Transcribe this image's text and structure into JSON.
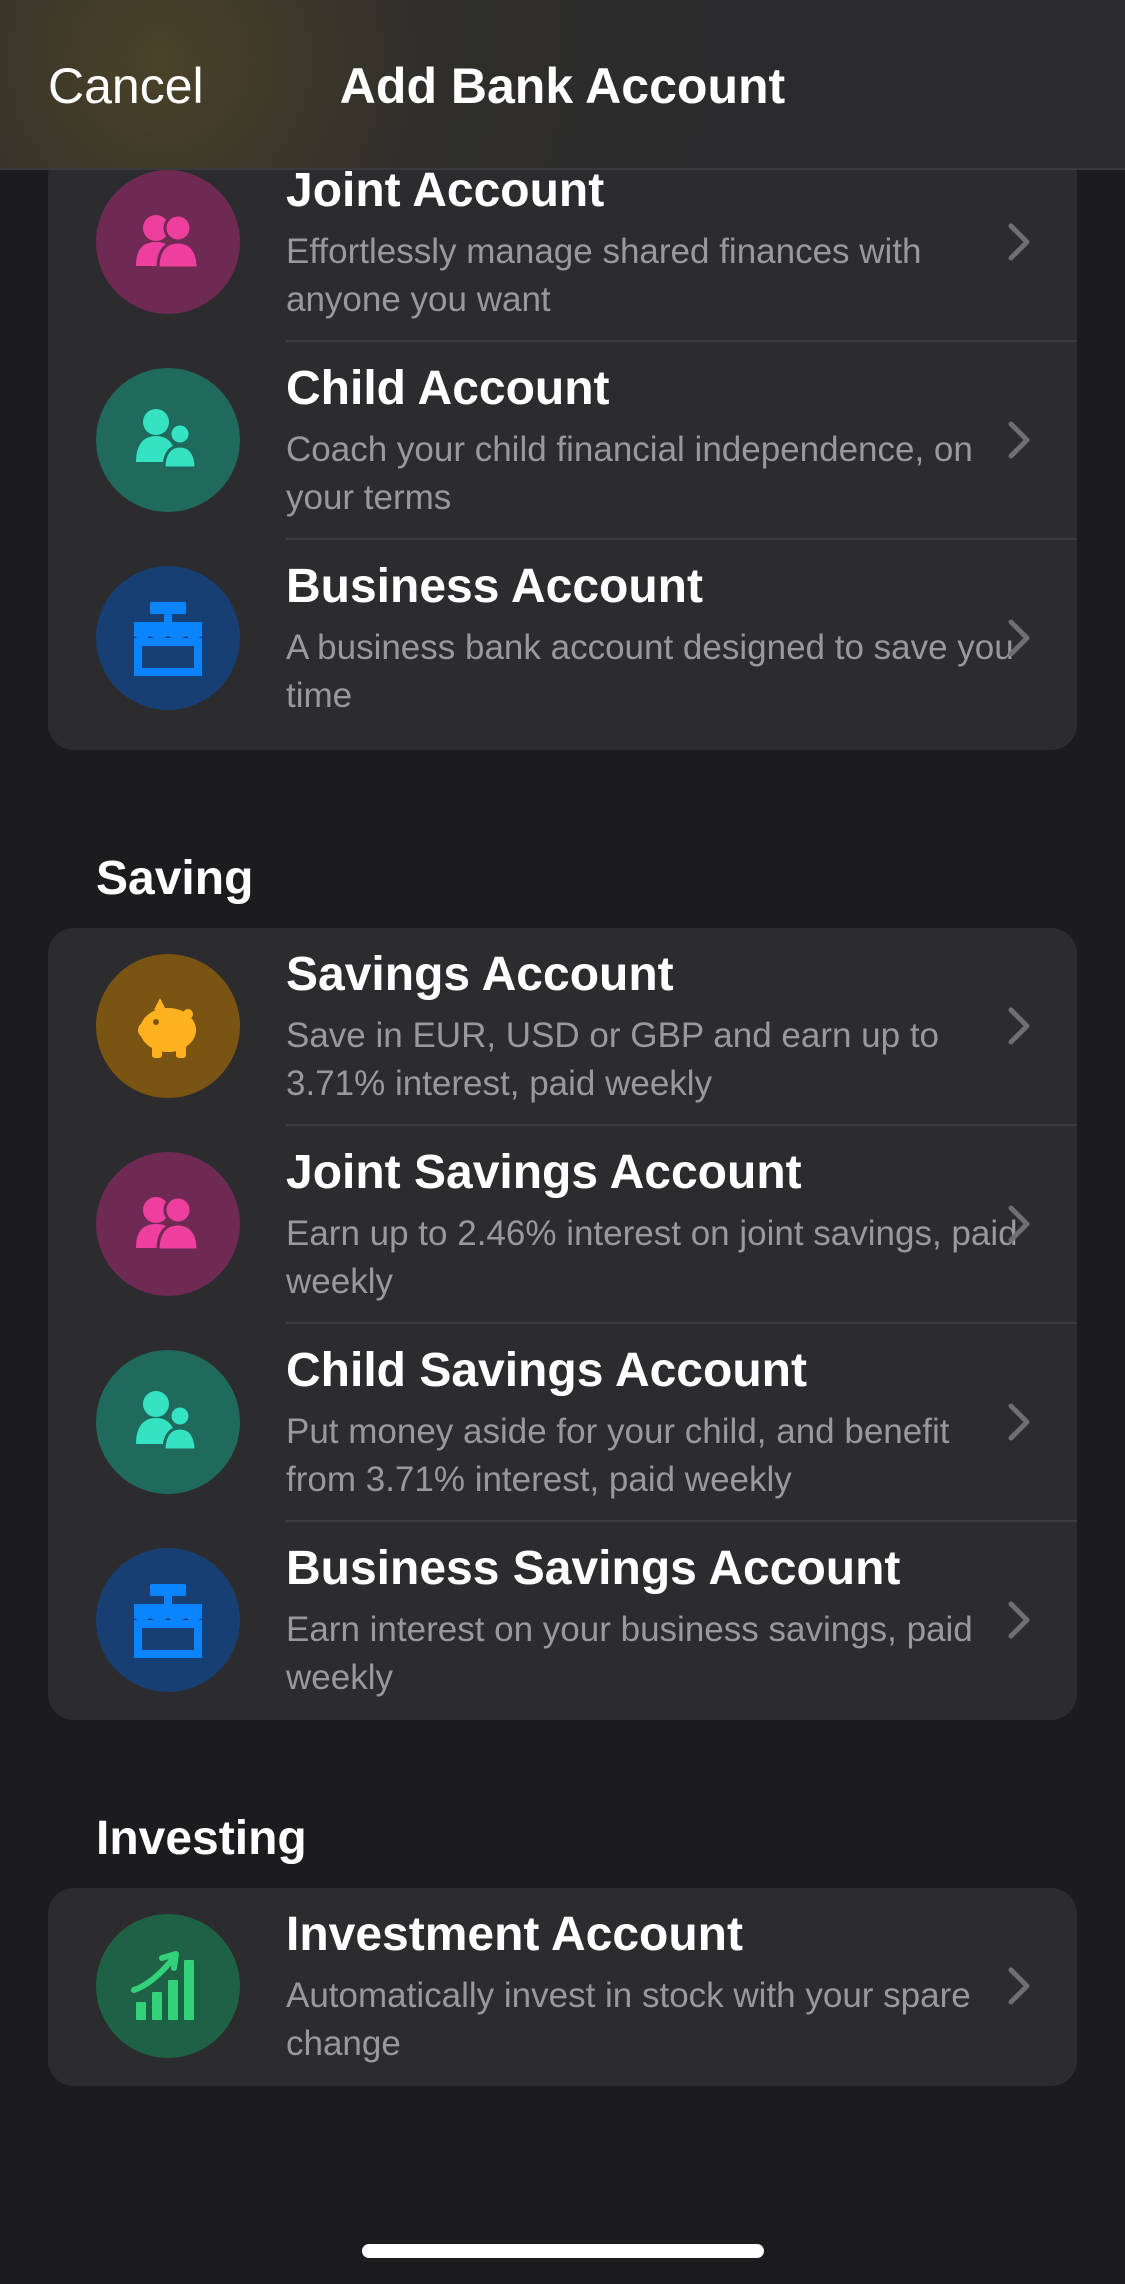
{
  "nav": {
    "cancel_label": "Cancel",
    "title": "Add Bank Account"
  },
  "sections": {
    "saving": {
      "title": "Saving"
    },
    "investing": {
      "title": "Investing"
    }
  },
  "accounts": {
    "joint": {
      "title": "Joint Account",
      "desc": "Effortlessly manage shared finances with anyone you want",
      "icon": "two-people-icon"
    },
    "child": {
      "title": "Child Account",
      "desc": "Coach your child financial independence, on your terms",
      "icon": "parent-child-icon"
    },
    "business": {
      "title": "Business Account",
      "desc": "A business bank account designed to save you time",
      "icon": "storefront-icon"
    },
    "savings": {
      "title": "Savings Account",
      "desc": "Save in EUR, USD or GBP and earn up to 3.71% interest, paid weekly",
      "icon": "piggy-bank-icon"
    },
    "joint_savings": {
      "title": "Joint Savings Account",
      "desc": "Earn up to 2.46% interest on joint savings, paid weekly",
      "icon": "two-people-icon"
    },
    "child_savings": {
      "title": "Child Savings Account",
      "desc": "Put money aside for your child, and benefit from 3.71% interest, paid weekly",
      "icon": "parent-child-icon"
    },
    "business_savings": {
      "title": "Business Savings Account",
      "desc": "Earn interest on your business savings, paid weekly",
      "icon": "storefront-icon"
    },
    "investment": {
      "title": "Investment Account",
      "desc": "Automatically invest in stock with your spare change",
      "icon": "growth-chart-icon"
    }
  },
  "colors": {
    "pink_bg": "#6e2a52",
    "pink_fg": "#ee3f9f",
    "teal_bg": "#1f6a5c",
    "teal_fg": "#35e3c3",
    "blue_bg": "#173f73",
    "blue_fg": "#0a84ff",
    "orange_bg": "#7a5412",
    "orange_fg": "#ffb21f",
    "green_bg": "#1f6144",
    "green_fg": "#33d17a"
  }
}
